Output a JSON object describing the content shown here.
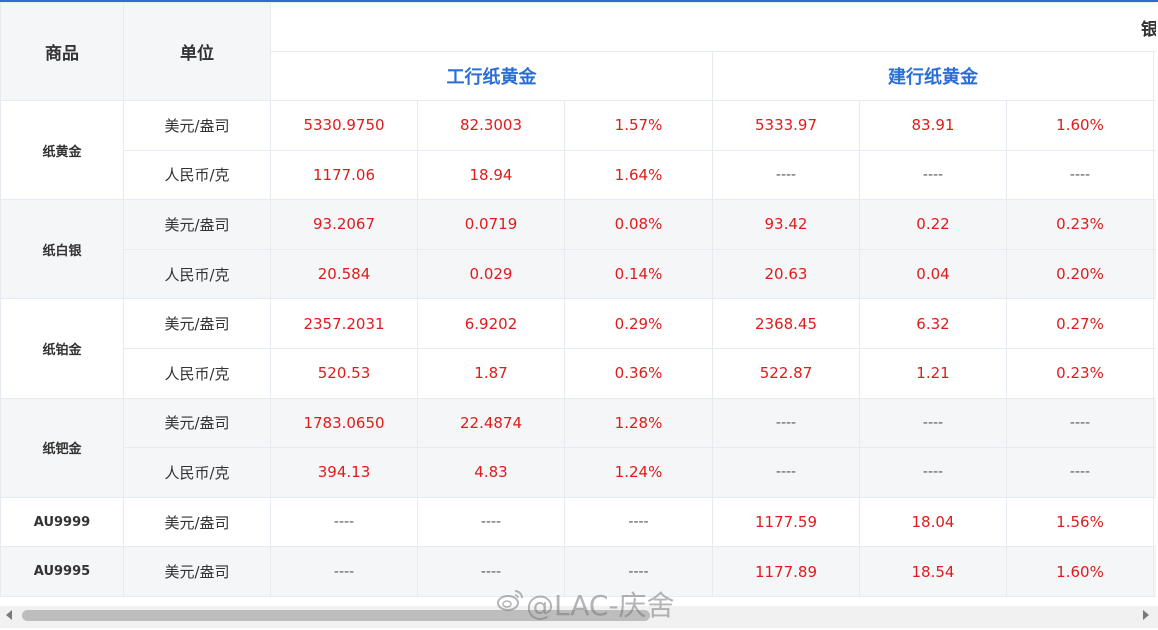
{
  "header": {
    "product_label": "商品",
    "unit_label": "单位",
    "group_label": "银",
    "bank1": "工行纸黄金",
    "bank2": "建行纸黄金"
  },
  "groups": [
    {
      "product": "纸黄金",
      "rows": [
        {
          "unit": "美元/盎司",
          "b1": [
            "5330.9750",
            "82.3003",
            "1.57%"
          ],
          "b2": [
            "5333.97",
            "83.91",
            "1.60%"
          ]
        },
        {
          "unit": "人民币/克",
          "b1": [
            "1177.06",
            "18.94",
            "1.64%"
          ],
          "b2": [
            "----",
            "----",
            "----"
          ]
        }
      ]
    },
    {
      "product": "纸白银",
      "rows": [
        {
          "unit": "美元/盎司",
          "b1": [
            "93.2067",
            "0.0719",
            "0.08%"
          ],
          "b2": [
            "93.42",
            "0.22",
            "0.23%"
          ]
        },
        {
          "unit": "人民币/克",
          "b1": [
            "20.584",
            "0.029",
            "0.14%"
          ],
          "b2": [
            "20.63",
            "0.04",
            "0.20%"
          ]
        }
      ]
    },
    {
      "product": "纸铂金",
      "rows": [
        {
          "unit": "美元/盎司",
          "b1": [
            "2357.2031",
            "6.9202",
            "0.29%"
          ],
          "b2": [
            "2368.45",
            "6.32",
            "0.27%"
          ]
        },
        {
          "unit": "人民币/克",
          "b1": [
            "520.53",
            "1.87",
            "0.36%"
          ],
          "b2": [
            "522.87",
            "1.21",
            "0.23%"
          ]
        }
      ]
    },
    {
      "product": "纸钯金",
      "rows": [
        {
          "unit": "美元/盎司",
          "b1": [
            "1783.0650",
            "22.4874",
            "1.28%"
          ],
          "b2": [
            "----",
            "----",
            "----"
          ]
        },
        {
          "unit": "人民币/克",
          "b1": [
            "394.13",
            "4.83",
            "1.24%"
          ],
          "b2": [
            "----",
            "----",
            "----"
          ]
        }
      ]
    },
    {
      "product": "AU9999",
      "rows": [
        {
          "unit": "美元/盎司",
          "b1": [
            "----",
            "----",
            "----"
          ],
          "b2": [
            "1177.59",
            "18.04",
            "1.56%"
          ]
        }
      ]
    },
    {
      "product": "AU9995",
      "rows": [
        {
          "unit": "美元/盎司",
          "b1": [
            "----",
            "----",
            "----"
          ],
          "b2": [
            "1177.89",
            "18.54",
            "1.60%"
          ]
        }
      ]
    }
  ],
  "watermark": "@LAC-庆舍",
  "colors": {
    "accent": "#2b6fd6",
    "value": "#e01b1b",
    "alt_row": "#f5f6f8"
  }
}
